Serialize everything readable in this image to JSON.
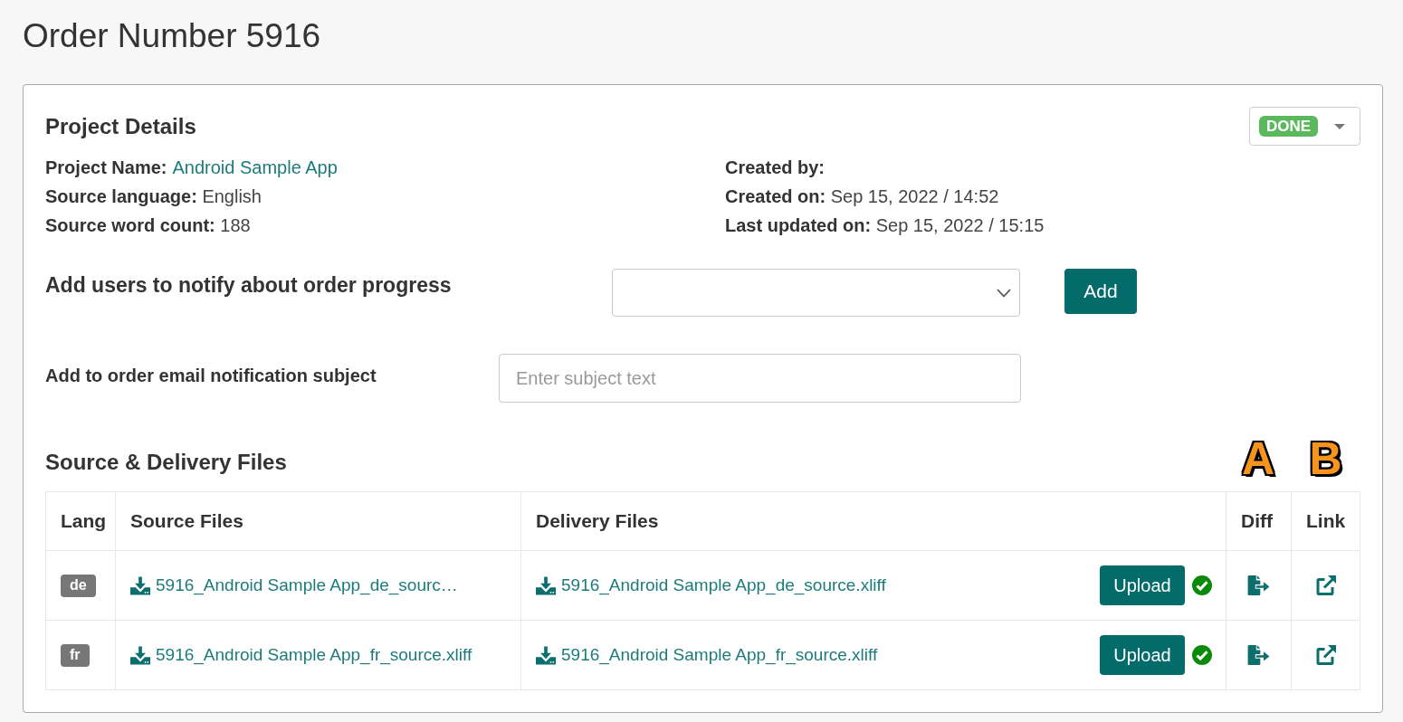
{
  "page": {
    "title": "Order Number 5916"
  },
  "project_details": {
    "title": "Project Details",
    "status": {
      "label": "DONE"
    },
    "fields_left": [
      {
        "label": "Project Name:",
        "value": "Android Sample App",
        "kind": "link"
      },
      {
        "label": "Source language:",
        "value": "English",
        "kind": "text"
      },
      {
        "label": "Source word count:",
        "value": "188",
        "kind": "text"
      }
    ],
    "fields_right": [
      {
        "label": "Created by:"
      },
      {
        "label": "Created on:",
        "value": "Sep 15, 2022 / 14:52",
        "kind": "text"
      },
      {
        "label": "Last updated on:",
        "value": "Sep 15, 2022 / 15:15",
        "kind": "text"
      }
    ]
  },
  "notify_users": {
    "label": "Add users to notify about order progress",
    "button": "Add"
  },
  "email_subject": {
    "label": "Add to order email notification subject",
    "placeholder": "Enter subject text"
  },
  "files": {
    "title": "Source & Delivery Files",
    "annotations": [
      "A",
      "B"
    ],
    "columns": [
      "Lang",
      "Source Files",
      "Delivery Files",
      "Diff",
      "Link"
    ],
    "rows": [
      {
        "lang": "de",
        "source_file": "5916_Android Sample App_de_sourc…",
        "delivery_file": "5916_Android Sample App_de_source.xliff",
        "upload_button": "Upload",
        "uploaded": true
      },
      {
        "lang": "fr",
        "source_file": "5916_Android Sample App_fr_source.xliff",
        "delivery_file": "5916_Android Sample App_fr_source.xliff",
        "upload_button": "Upload",
        "uploaded": true
      }
    ]
  }
}
